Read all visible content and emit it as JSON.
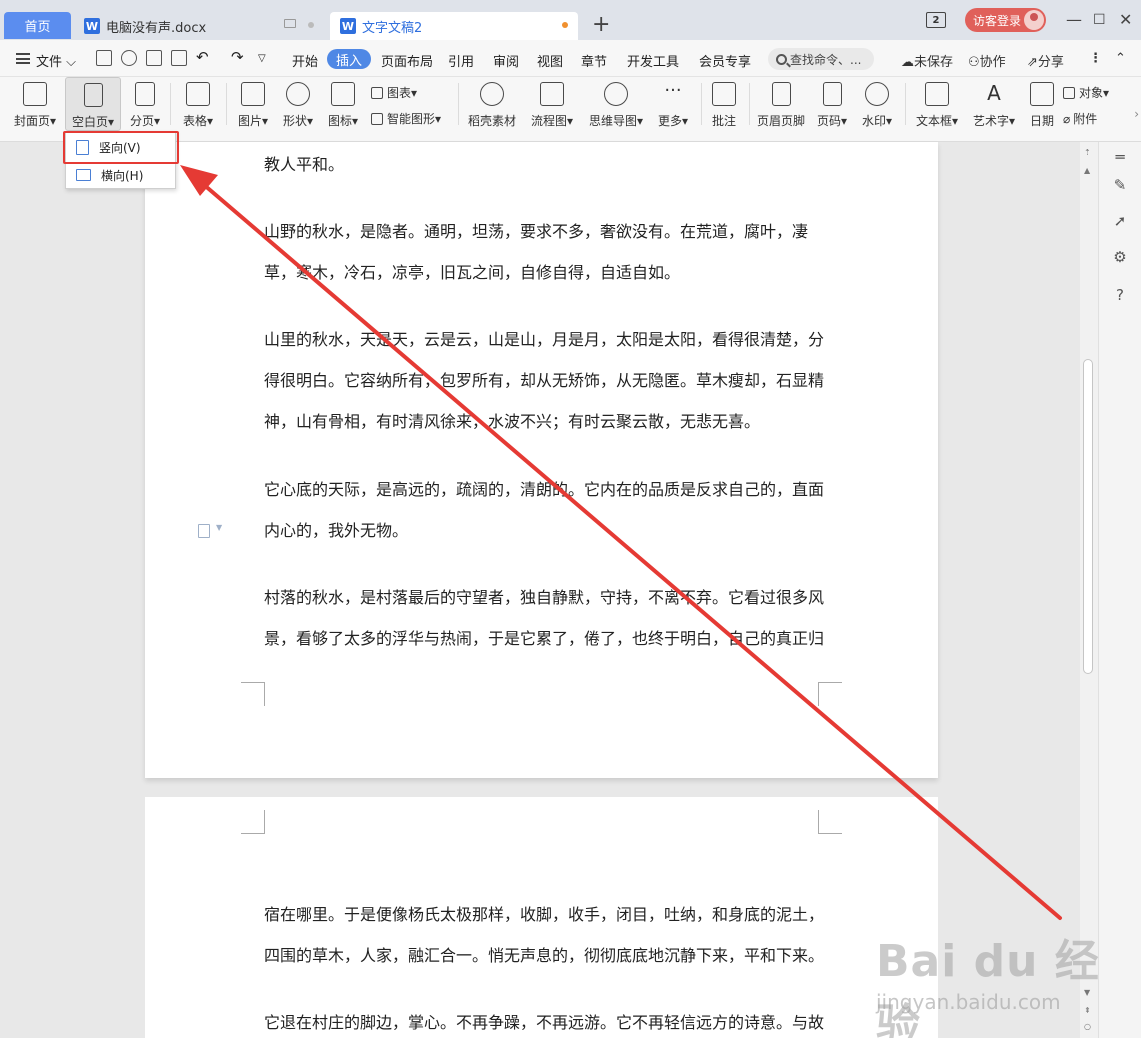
{
  "titlebar": {
    "home_tab": "首页",
    "tabs": [
      {
        "label": "电脑没有声.docx",
        "icon": "W"
      },
      {
        "label": "文字文稿2",
        "icon": "W"
      }
    ],
    "window_count": "2",
    "login_label": "访客登录"
  },
  "menubar": {
    "file": "文件",
    "items": [
      "开始",
      "插入",
      "页面布局",
      "引用",
      "审阅",
      "视图",
      "章节",
      "开发工具",
      "会员专享"
    ],
    "active_item": "插入",
    "search_placeholder": "查找命令、...",
    "unsaved": "未保存",
    "collab": "协作",
    "share": "分享"
  },
  "ribbon": {
    "cover": "封面页",
    "blank_page": "空白页",
    "page_break": "分页",
    "table": "表格",
    "picture": "图片",
    "shape": "形状",
    "icon": "图标",
    "chart": "图表",
    "smart_shape": "智能图形",
    "docer": "稻壳素材",
    "flowchart": "流程图",
    "mindmap": "思维导图",
    "more": "更多",
    "comment": "批注",
    "header_footer": "页眉页脚",
    "page_number": "页码",
    "watermark": "水印",
    "textbox": "文本框",
    "wordart": "艺术字",
    "date": "日期",
    "object": "对象",
    "attachment": "附件"
  },
  "dropdown": {
    "portrait": "竖向(V)",
    "landscape": "横向(H)"
  },
  "document": {
    "page1_paragraphs": [
      "教人平和。",
      "山野的秋水，是隐者。通明，坦荡，要求不多，奢欲没有。在荒道，腐叶，凄草，寒木，冷石，凉亭，旧瓦之间，自修自得，自适自如。",
      "山里的秋水，天是天，云是云，山是山，月是月，太阳是太阳，看得很清楚，分得很明白。它容纳所有，包罗所有，却从无矫饰，从无隐匿。草木瘦却，石显精神，山有骨相，有时清风徐来，水波不兴；有时云聚云散，无悲无喜。",
      "它心底的天际，是高远的，疏阔的，清朗的。它内在的品质是反求自己的，直面内心的，我外无物。",
      "村落的秋水，是村落最后的守望者，独自静默，守持，不离不弃。它看过很多风景，看够了太多的浮华与热闹，于是它累了，倦了，也终于明白，自己的真正归"
    ],
    "page2_paragraphs": [
      "宿在哪里。于是便像杨氏太极那样，收脚，收手，闭目，吐纳，和身底的泥土，四围的草木，人家，融汇合一。悄无声息的，彻彻底底地沉静下来，平和下来。",
      "它退在村庄的脚边，掌心。不再争躁，不再远游。它不再轻信远方的诗意。与故"
    ]
  },
  "watermark": {
    "brand": "Bai du 经验",
    "url": "jingyan.baidu.com"
  },
  "colors": {
    "accent": "#4f88e5",
    "highlight_box": "#e53a34",
    "login": "#e0605a"
  }
}
